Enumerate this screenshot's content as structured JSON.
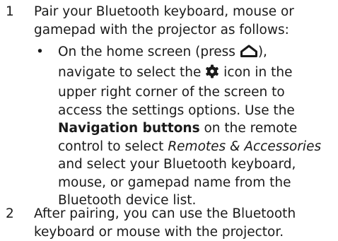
{
  "steps": [
    {
      "number": "1",
      "lines": [
        "Pair your Bluetooth keyboard, mouse or",
        "gamepad with the projector as follows:"
      ]
    },
    {
      "number": "2",
      "lines": [
        "After pairing, you can use the Bluetooth",
        "keyboard or mouse with the projector."
      ]
    }
  ],
  "bullet": {
    "marker": "•",
    "line1_pre": "On the home screen (press ",
    "line1_post": "),",
    "line2_pre": "navigate to select the ",
    "line2_post": " icon in the",
    "line3": "upper right corner of the screen to",
    "line4": "access the settings options. Use the",
    "line5_bold": "Navigation buttons",
    "line5_post": " on the remote",
    "line6_pre": "control to select ",
    "line6_italic": "Remotes & Accessories",
    "line7": "and select your Bluetooth keyboard,",
    "line8": "mouse, or gamepad name from the",
    "line9": "Bluetooth device list.",
    "home_icon": "home-icon",
    "settings_icon": "gear-icon"
  }
}
